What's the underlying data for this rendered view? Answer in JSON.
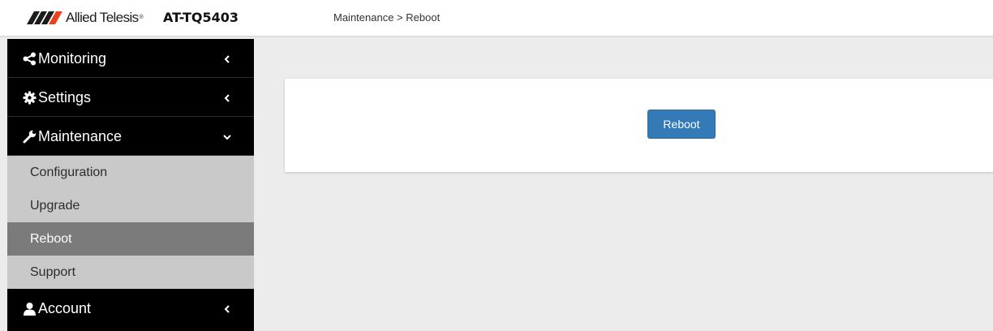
{
  "header": {
    "brand_text": "Allied Telesis",
    "brand_registered": "®",
    "model": "AT-TQ5403",
    "breadcrumb": "Maintenance > Reboot"
  },
  "sidebar": {
    "items": [
      {
        "label": "Monitoring",
        "icon": "share-icon",
        "chevron": "chevron-left-icon"
      },
      {
        "label": "Settings",
        "icon": "gear-icon",
        "chevron": "chevron-left-icon"
      },
      {
        "label": "Maintenance",
        "icon": "wrench-icon",
        "chevron": "chevron-down-icon",
        "expanded": true
      },
      {
        "label": "Account",
        "icon": "user-icon",
        "chevron": "chevron-left-icon"
      }
    ],
    "submenu": [
      {
        "label": "Configuration"
      },
      {
        "label": "Upgrade"
      },
      {
        "label": "Reboot",
        "active": true
      },
      {
        "label": "Support"
      }
    ]
  },
  "main": {
    "reboot_button_label": "Reboot"
  },
  "colors": {
    "sidebar_bg": "#000000",
    "submenu_bg": "#c9c9c9",
    "submenu_active_bg": "#7b7b7b",
    "content_bg": "#ececec",
    "button_bg": "#337ab7",
    "logo_accent": "#e8431c"
  }
}
